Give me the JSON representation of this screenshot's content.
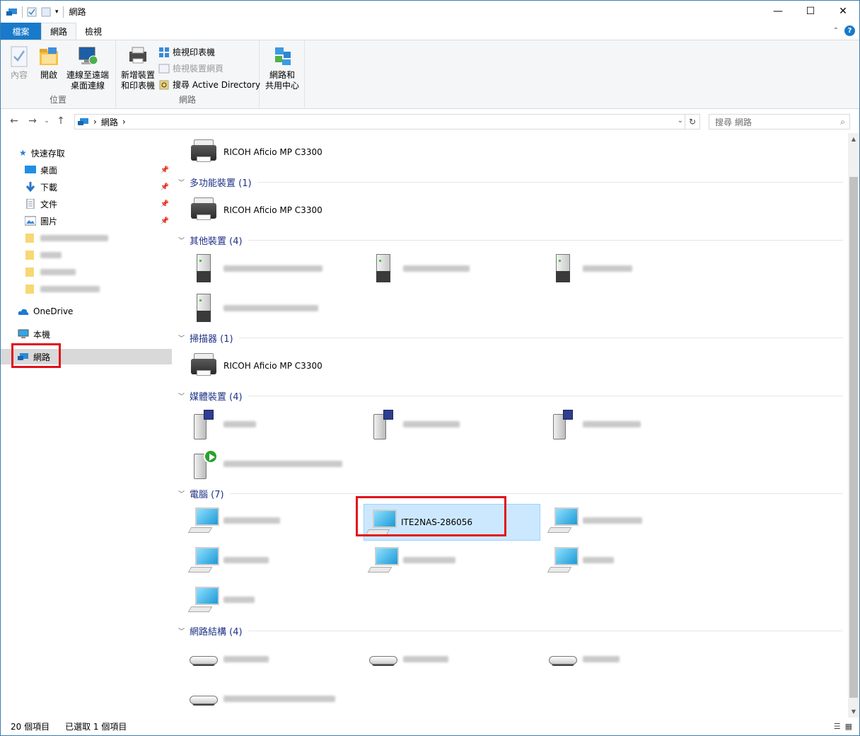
{
  "window": {
    "title": "網路"
  },
  "ribbon": {
    "tabs": [
      "檔案",
      "網路",
      "檢視"
    ],
    "groups": {
      "location": {
        "label": "位置",
        "properties": "內容",
        "open": "開啟",
        "remote_line1": "連線至遠端",
        "remote_line2": "桌面連線"
      },
      "network": {
        "label": "網路",
        "add_line1": "新增裝置",
        "add_line2": "和印表機",
        "view_printers": "檢視印表機",
        "view_device_page": "檢視裝置網頁",
        "search_ad": "搜尋 Active Directory"
      },
      "center": {
        "line1": "網路和",
        "line2": "共用中心"
      }
    }
  },
  "address": {
    "crumb": "網路",
    "sep": "›",
    "search_placeholder": "搜尋 網路"
  },
  "navpane": {
    "quick_access": "快速存取",
    "items": [
      "桌面",
      "下載",
      "文件",
      "圖片"
    ],
    "onedrive": "OneDrive",
    "this_pc": "本機",
    "network": "網路"
  },
  "groups": {
    "top_printer": "RICOH Aficio MP C3300",
    "multifunction": {
      "header": "多功能裝置 (1)",
      "item": "RICOH Aficio MP C3300"
    },
    "other": {
      "header": "其他裝置 (4)"
    },
    "scanner": {
      "header": "掃描器 (1)",
      "item": "RICOH Aficio MP C3300"
    },
    "media": {
      "header": "媒體裝置 (4)"
    },
    "computers": {
      "header": "電腦 (7)",
      "selected": "ITE2NAS-286056"
    },
    "infrastructure": {
      "header": "網路結構 (4)"
    }
  },
  "status": {
    "count": "20 個項目",
    "selected": "已選取 1 個項目"
  },
  "colors": {
    "accent": "#1979ca",
    "highlight_box": "#e2111b",
    "selection": "#cce8ff",
    "group_header": "#1e3287"
  }
}
